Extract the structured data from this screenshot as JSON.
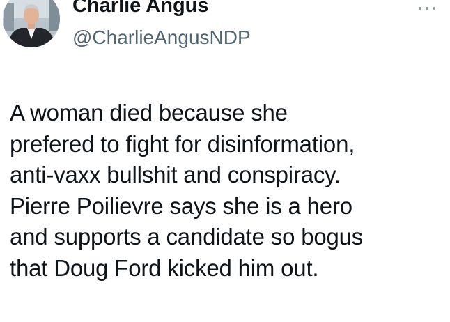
{
  "author": {
    "display_name": "Charlie Angus",
    "handle": "@CharlieAngusNDP"
  },
  "icons": {
    "avatar": "profile-photo",
    "more": "more-options-icon"
  },
  "tweet": {
    "lines": [
      "A woman died because she",
      "prefered to fight for disinformation,",
      "anti-vaxx bullshit and conspiracy.",
      "Pierre Poilievre says she is a hero",
      "and supports a candidate so bogus",
      "that Doug Ford kicked him out."
    ]
  },
  "colors": {
    "text": "#0f1419",
    "secondary": "#536471",
    "background": "#ffffff"
  }
}
